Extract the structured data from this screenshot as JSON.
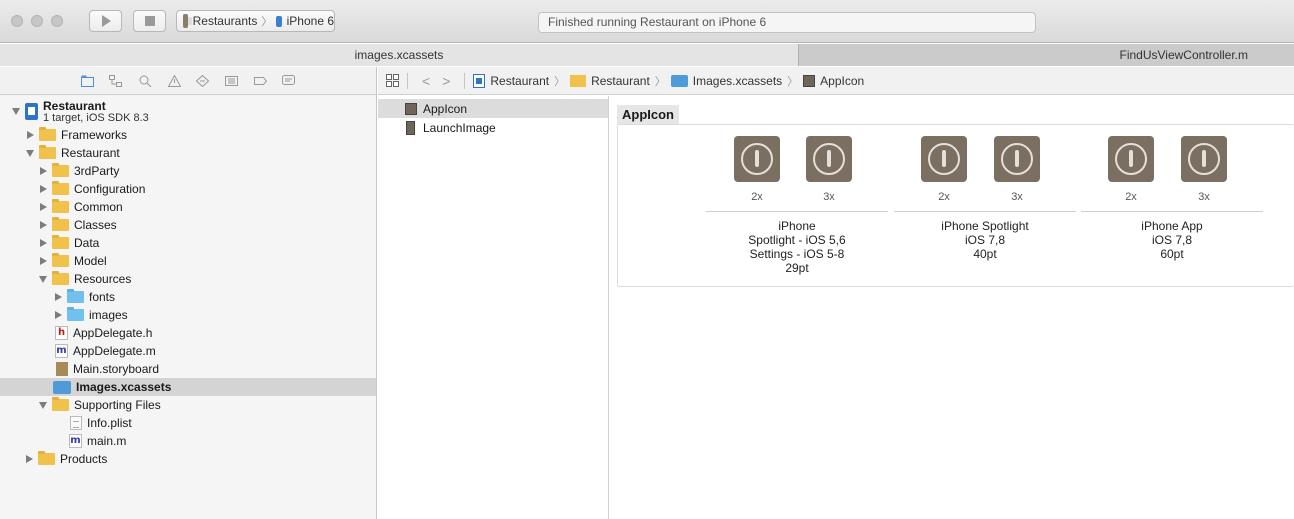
{
  "toolbar": {
    "scheme": {
      "project": "Restaurants",
      "device": "iPhone 6"
    },
    "activity_text": "Finished running Restaurant on iPhone 6"
  },
  "tabs": [
    {
      "label": "images.xcassets",
      "active": true
    },
    {
      "label": "FindUsViewController.m",
      "active": false
    }
  ],
  "navigator": {
    "selector_icons": [
      "folder-icon",
      "symbol-icon",
      "search-icon",
      "warning-icon",
      "test-icon",
      "debug-icon",
      "breakpoint-icon",
      "log-icon"
    ],
    "project": {
      "name": "Restaurant",
      "subtitle": "1 target, iOS SDK 8.3"
    },
    "items": [
      {
        "label": "Frameworks"
      },
      {
        "label": "Restaurant"
      },
      {
        "label": "3rdParty"
      },
      {
        "label": "Configuration"
      },
      {
        "label": "Common"
      },
      {
        "label": "Classes"
      },
      {
        "label": "Data"
      },
      {
        "label": "Model"
      },
      {
        "label": "Resources"
      },
      {
        "label": "fonts"
      },
      {
        "label": "images"
      },
      {
        "label": "AppDelegate.h"
      },
      {
        "label": "AppDelegate.m"
      },
      {
        "label": "Main.storyboard"
      },
      {
        "label": "Images.xcassets"
      },
      {
        "label": "Supporting Files"
      },
      {
        "label": "Info.plist"
      },
      {
        "label": "main.m"
      },
      {
        "label": "Products"
      }
    ]
  },
  "jumpbar": {
    "crumbs": [
      "Restaurant",
      "Restaurant",
      "Images.xcassets",
      "AppIcon"
    ]
  },
  "asset_list": [
    {
      "label": "AppIcon",
      "selected": true
    },
    {
      "label": "LaunchImage",
      "selected": false
    }
  ],
  "editor": {
    "set_title": "AppIcon",
    "scale_labels": [
      "2x",
      "3x",
      "2x",
      "3x",
      "2x",
      "3x"
    ],
    "groups": [
      {
        "label": "iPhone\nSpotlight - iOS 5,6\nSettings - iOS 5-8\n29pt"
      },
      {
        "label": "iPhone Spotlight\niOS 7,8\n40pt"
      },
      {
        "label": "iPhone App\niOS 7,8\n60pt"
      }
    ]
  },
  "colors": {
    "folder": "#f0c24c",
    "blue_folder": "#72c0ee",
    "icon_tile": "#7a6f61",
    "selection": "#d4d4d4"
  }
}
